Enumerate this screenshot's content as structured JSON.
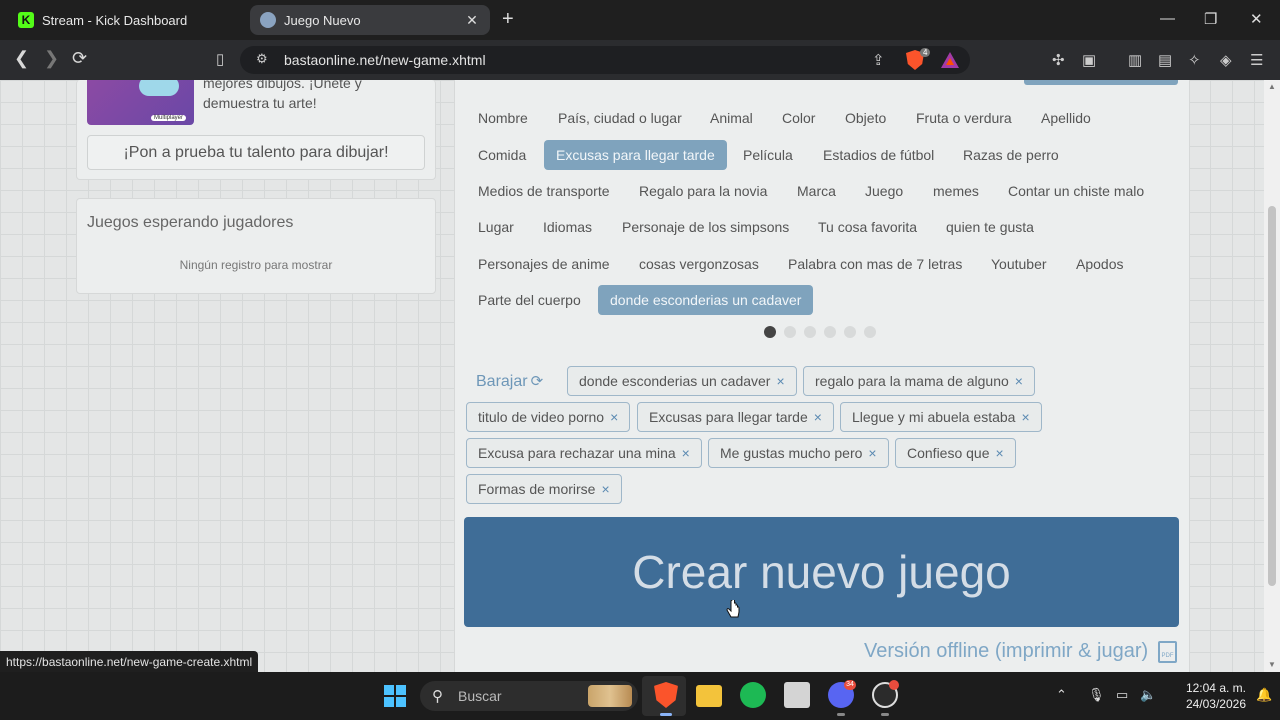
{
  "browser": {
    "tabs": [
      {
        "title": "Stream - Kick Dashboard",
        "favicon": "kick-icon"
      },
      {
        "title": "Juego Nuevo",
        "favicon": "globe-icon"
      }
    ],
    "url": "bastaonline.net/new-game.xhtml",
    "shield_count": "4",
    "status_url": "https://bastaonline.net/new-game-create.xhtml"
  },
  "page": {
    "promo_text": "mejores dibujos. ¡Únete y demuestra tu arte!",
    "promo_tag": "Multiplayer",
    "draw_button": "¡Pon a prueba tu talento para dibujar!",
    "waiting_title": "Juegos esperando jugadores",
    "waiting_empty": "Ningún registro para mostrar",
    "categories": [
      "Nombre",
      "País, ciudad o lugar",
      "Animal",
      "Color",
      "Objeto",
      "Fruta o verdura",
      "Apellido",
      "Comida",
      "Excusas para llegar tarde",
      "Película",
      "Estadios de fútbol",
      "Razas de perro",
      "Medios de transporte",
      "Regalo para la novia",
      "Marca",
      "Juego",
      "memes",
      "Contar un chiste malo",
      "Lugar",
      "Idiomas",
      "Personaje de los simpsons",
      "Tu cosa favorita",
      "quien te gusta",
      "Personajes de anime",
      "cosas vergonzosas",
      "Palabra con mas de 7 letras",
      "Youtuber",
      "Apodos",
      "Parte del cuerpo",
      "donde esconderias un cadaver"
    ],
    "selected_categories": [
      "Excusas para llegar tarde",
      "donde esconderias un cadaver"
    ],
    "pagination": {
      "pages": 6,
      "current": 1
    },
    "shuffle_label": "Barajar",
    "chips": [
      "donde esconderias un cadaver",
      "regalo para la mama de alguno",
      "titulo de video porno",
      "Excusas para llegar tarde",
      "Llegue y mi abuela estaba",
      "Excusa para rechazar una mina",
      "Me gustas mucho pero",
      "Confieso que",
      "Formas de morirse"
    ],
    "chip_remove": "×",
    "create_button": "Crear nuevo juego",
    "offline_link": "Versión offline (imprimir & jugar)",
    "pdf_label": "PDF"
  },
  "taskbar": {
    "search_placeholder": "Buscar",
    "discord_badge": "34",
    "time": "12:04 a. m.",
    "date": "24/03/2026"
  },
  "colors": {
    "accent": "#3f6d97",
    "selected_chip": "#7fa3bd",
    "link": "#7fa7c6"
  }
}
